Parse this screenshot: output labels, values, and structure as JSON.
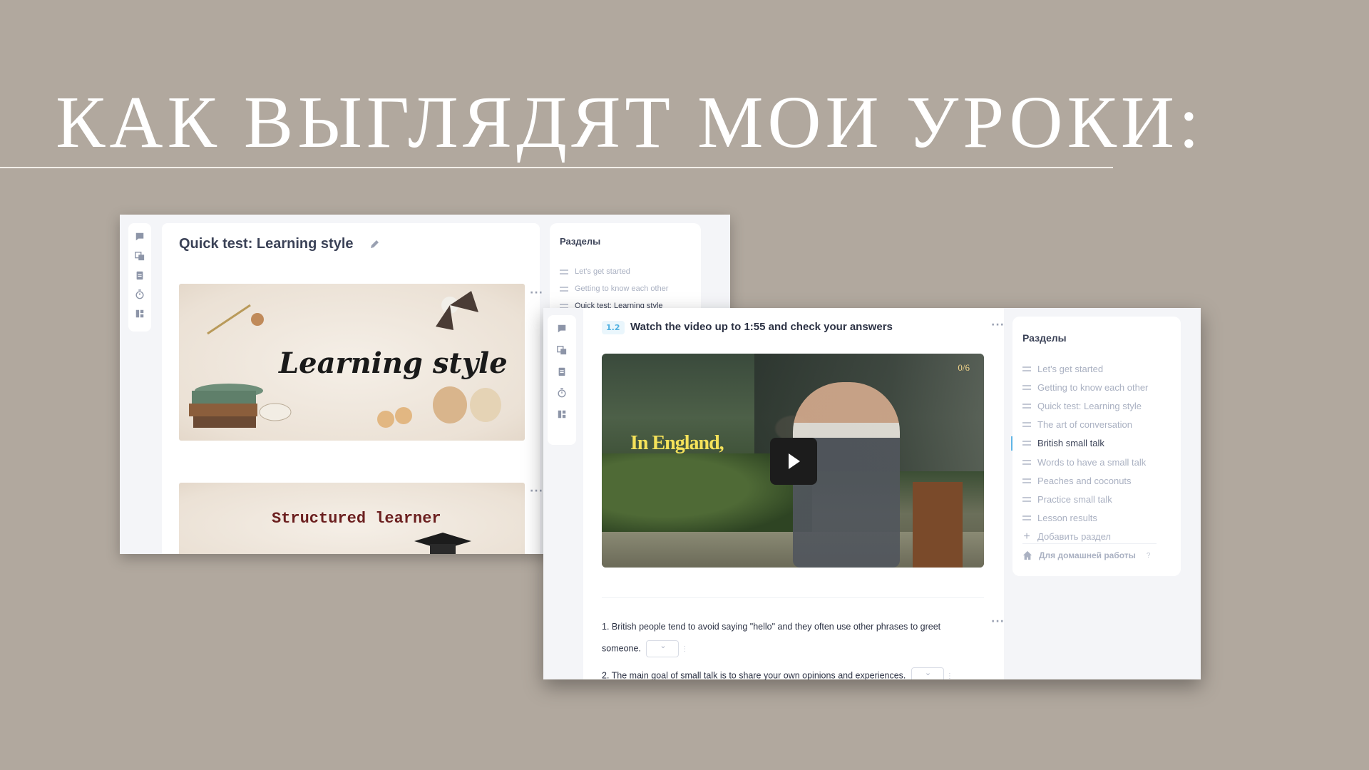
{
  "headline": "Как выглядят мои уроки:",
  "shot1": {
    "lesson_title": "Quick test: Learning style",
    "banner1_text": "Learning style",
    "banner2_text": "Structured learner",
    "kebab": "···",
    "sections": {
      "title": "Разделы",
      "items": [
        {
          "label": "Let's get started"
        },
        {
          "label": "Getting to know each other"
        },
        {
          "label": "Quick test: Learning style"
        }
      ]
    }
  },
  "shot2": {
    "task_number": "1.2",
    "task_title": "Watch the video up to 1:55 and check your answers",
    "kebab": "···",
    "video": {
      "counter": "0/6",
      "subtitle": "In England,"
    },
    "questions": [
      {
        "line1": "1. British people tend to avoid saying \"hello\" and they often use other phrases to greet",
        "line2": "someone."
      },
      {
        "line1": "2. The main goal of small talk is to share your own opinions and experiences."
      }
    ],
    "sections": {
      "title": "Разделы",
      "items": [
        {
          "label": "Let's get started"
        },
        {
          "label": "Getting to know each other"
        },
        {
          "label": "Quick test: Learning style"
        },
        {
          "label": "The art of conversation"
        },
        {
          "label": "British small talk",
          "active": true
        },
        {
          "label": "Words to have a small talk"
        },
        {
          "label": "Peaches and coconuts"
        },
        {
          "label": "Practice small talk"
        },
        {
          "label": "Lesson results"
        }
      ],
      "add_label": "Добавить раздел",
      "homework_label": "Для домашней работы",
      "help": "?"
    }
  },
  "colors": {
    "background": "#b1a89e",
    "accent": "#4fb0e0",
    "subtitle_yellow": "#f5e25a"
  },
  "icons": [
    "chat-icon",
    "translate-icon",
    "clipboard-icon",
    "timer-icon",
    "layout-icon",
    "pencil-icon",
    "drag-handle-icon",
    "plus-icon",
    "home-icon",
    "play-icon",
    "more-icon"
  ]
}
